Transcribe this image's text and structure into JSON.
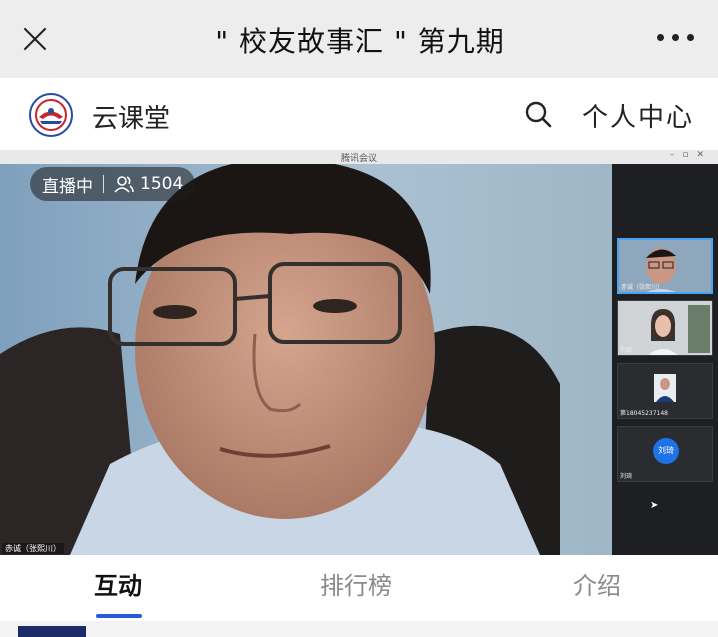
{
  "header": {
    "title": "\" 校友故事汇 \" 第九期",
    "close_icon": "close-icon",
    "more_icon": "more-icon"
  },
  "nav": {
    "brand": "云课堂",
    "personal": "个人中心",
    "search_icon": "search-icon",
    "logo_icon": "school-logo-icon"
  },
  "video": {
    "window_title": "腾讯会议",
    "live_status": "直播中",
    "viewer_count": "1504",
    "speaker_name": "赤诚（张熙川）",
    "participants": [
      {
        "name": "赤诚（张熙川）"
      },
      {
        "name": "刘琦"
      },
      {
        "name": "第18045237148"
      },
      {
        "name": "刘琦",
        "avatar_text": "刘琦"
      }
    ]
  },
  "tabs": [
    {
      "label": "互动",
      "active": true
    },
    {
      "label": "排行榜",
      "active": false
    },
    {
      "label": "介绍",
      "active": false
    }
  ],
  "colors": {
    "accent": "#2a5bd7",
    "titlebar_bg": "#ededed",
    "live_badge_bg": "#1e1e1e",
    "avatar_blue": "#1e73e8"
  }
}
